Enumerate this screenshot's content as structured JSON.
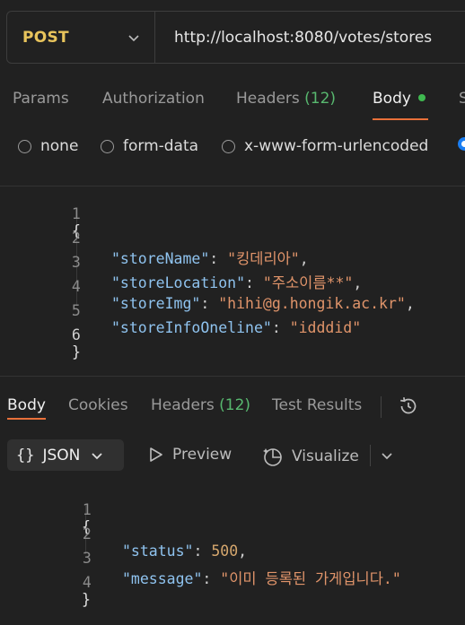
{
  "request": {
    "method": "POST",
    "url": "http://localhost:8080/votes/stores"
  },
  "request_tabs": [
    {
      "label": "Params"
    },
    {
      "label": "Authorization"
    },
    {
      "label": "Headers",
      "count": "(12)"
    },
    {
      "label": "Body",
      "active": true
    },
    {
      "label": "S"
    }
  ],
  "body_types": [
    "none",
    "form-data",
    "x-www-form-urlencoded"
  ],
  "request_body": {
    "line_numbers": [
      "1",
      "2",
      "3",
      "4",
      "5",
      "6"
    ],
    "open_brace": "{",
    "close_brace": "}",
    "fields": [
      {
        "key": "\"storeName\"",
        "value": "\"킹데리아\"",
        "comma": ","
      },
      {
        "key": "\"storeLocation\"",
        "value": "\"주소이름**\"",
        "comma": ","
      },
      {
        "key": "\"storeImg\"",
        "value": "\"hihi@g.hongik.ac.kr\"",
        "comma": ","
      },
      {
        "key": "\"storeInfoOneline\"",
        "value": "\"idddid\"",
        "comma": ""
      }
    ]
  },
  "response_tabs": [
    {
      "label": "Body",
      "active": true
    },
    {
      "label": "Cookies"
    },
    {
      "label": "Headers",
      "count": "(12)"
    },
    {
      "label": "Test Results"
    }
  ],
  "response_toolbar": {
    "format": "JSON",
    "preview": "Preview",
    "visualize": "Visualize"
  },
  "response_body": {
    "line_numbers": [
      "1",
      "2",
      "3",
      "4"
    ],
    "open_brace": "{",
    "close_brace": "}",
    "fields": [
      {
        "key": "\"status\"",
        "value": "500",
        "comma": ","
      },
      {
        "key": "\"message\"",
        "value": "\"이미 등록된 가게입니다.\"",
        "comma": ""
      }
    ]
  },
  "colors": {
    "background": "#212121",
    "method": "#e8c45c",
    "accent": "#e8703a",
    "count": "#58b86f",
    "key": "#8fc3ef",
    "string": "#e0946a",
    "radio_selected": "#1a7ef2"
  },
  "icons": [
    "chevron-down-icon",
    "history-icon",
    "json-braces-icon",
    "play-icon",
    "visualize-icon"
  ]
}
